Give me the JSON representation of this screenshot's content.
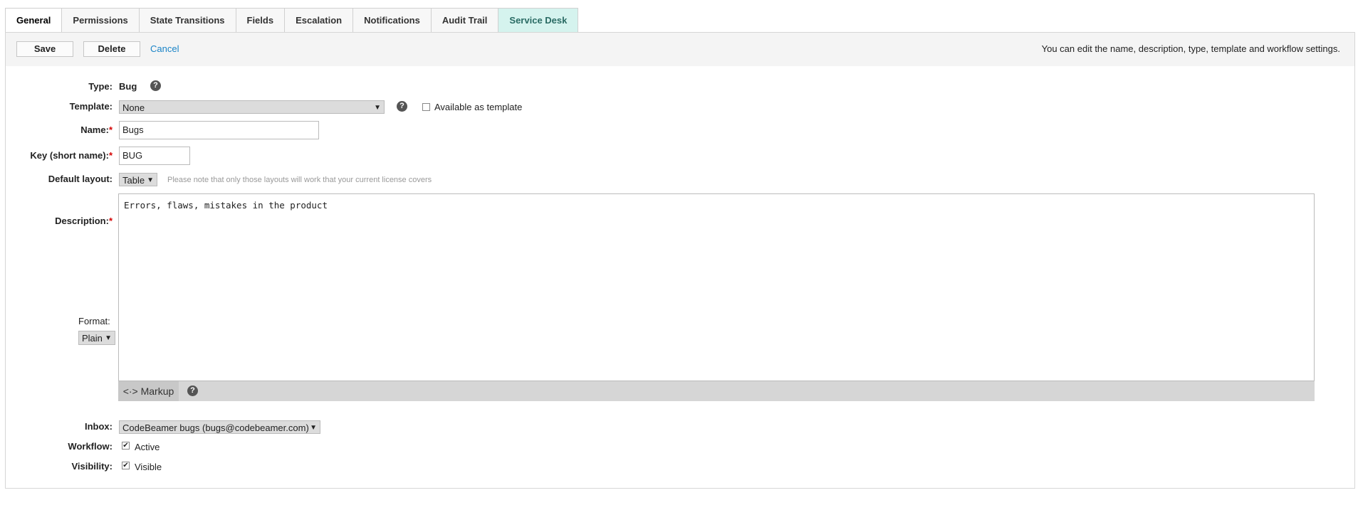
{
  "tabs": [
    {
      "label": "General"
    },
    {
      "label": "Permissions"
    },
    {
      "label": "State Transitions"
    },
    {
      "label": "Fields"
    },
    {
      "label": "Escalation"
    },
    {
      "label": "Notifications"
    },
    {
      "label": "Audit Trail"
    },
    {
      "label": "Service Desk"
    }
  ],
  "actions": {
    "save": "Save",
    "delete": "Delete",
    "cancel": "Cancel",
    "hint": "You can edit the name, description, type, template and workflow settings."
  },
  "form": {
    "type_label": "Type:",
    "type_value": "Bug",
    "template_label": "Template:",
    "template_value": "None",
    "available_template_label": "Available as template",
    "name_label": "Name:",
    "name_value": "Bugs",
    "key_label": "Key (short name):",
    "key_value": "BUG",
    "layout_label": "Default layout:",
    "layout_value": "Table",
    "layout_note": "Please note that only those layouts will work that your current license covers",
    "description_label": "Description:",
    "description_value": "Errors, flaws, mistakes in the product",
    "format_label": "Format:",
    "format_value": "Plain",
    "markup_label": "Markup",
    "inbox_label": "Inbox:",
    "inbox_value": "CodeBeamer bugs (bugs@codebeamer.com)",
    "workflow_label": "Workflow:",
    "workflow_value": "Active",
    "visibility_label": "Visibility:",
    "visibility_value": "Visible",
    "required_mark": "*",
    "help_glyph": "?"
  },
  "colors": {
    "accent": "#1a84c7",
    "service_desk_tab": "#d5f3ee",
    "required": "#d40000"
  }
}
